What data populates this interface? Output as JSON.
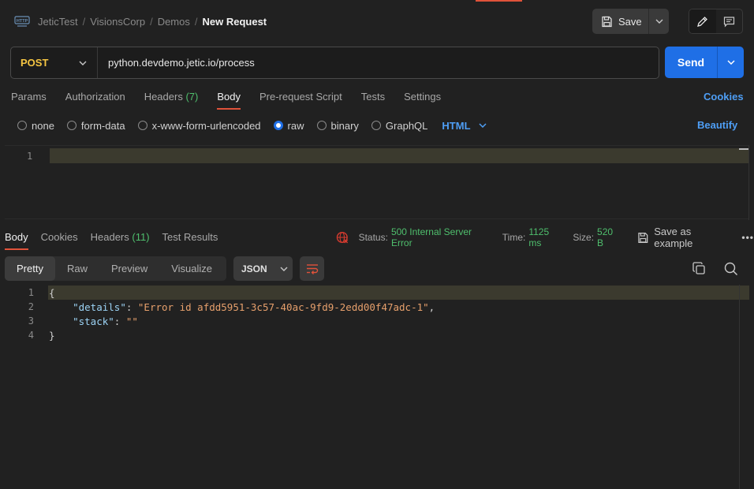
{
  "header": {
    "breadcrumb": [
      "JeticTest",
      "VisionsCorp",
      "Demos"
    ],
    "current": "New Request",
    "save_label": "Save"
  },
  "request": {
    "method": "POST",
    "url": "python.devdemo.jetic.io/process",
    "send_label": "Send"
  },
  "request_tabs": [
    {
      "label": "Params",
      "count": "",
      "active": false
    },
    {
      "label": "Authorization",
      "count": "",
      "active": false
    },
    {
      "label": "Headers",
      "count": "(7)",
      "active": false
    },
    {
      "label": "Body",
      "count": "",
      "active": true
    },
    {
      "label": "Pre-request Script",
      "count": "",
      "active": false
    },
    {
      "label": "Tests",
      "count": "",
      "active": false
    },
    {
      "label": "Settings",
      "count": "",
      "active": false
    }
  ],
  "cookies_link": "Cookies",
  "body_types": [
    {
      "label": "none",
      "checked": false
    },
    {
      "label": "form-data",
      "checked": false
    },
    {
      "label": "x-www-form-urlencoded",
      "checked": false
    },
    {
      "label": "raw",
      "checked": true
    },
    {
      "label": "binary",
      "checked": false
    },
    {
      "label": "GraphQL",
      "checked": false
    }
  ],
  "raw_format": "HTML",
  "beautify_label": "Beautify",
  "editor": {
    "line_numbers": [
      "1"
    ]
  },
  "response_tabs": [
    {
      "label": "Body",
      "count": "",
      "active": true
    },
    {
      "label": "Cookies",
      "count": "",
      "active": false
    },
    {
      "label": "Headers",
      "count": "(11)",
      "active": false
    },
    {
      "label": "Test Results",
      "count": "",
      "active": false
    }
  ],
  "status": {
    "status_label": "Status:",
    "status_value": "500 Internal Server Error",
    "time_label": "Time:",
    "time_value": "1125 ms",
    "size_label": "Size:",
    "size_value": "520 B",
    "save_example_label": "Save as example",
    "more_label": "•••"
  },
  "view_tabs": [
    {
      "label": "Pretty",
      "active": true
    },
    {
      "label": "Raw",
      "active": false
    },
    {
      "label": "Preview",
      "active": false
    },
    {
      "label": "Visualize",
      "active": false
    }
  ],
  "response_format": "JSON",
  "response_lines": [
    {
      "num": "1",
      "text": "{"
    },
    {
      "num": "2",
      "key": "\"details\"",
      "sep": ": ",
      "value": "\"Error id afdd5951-3c57-40ac-9fd9-2edd00f47adc-1\"",
      "end": ","
    },
    {
      "num": "3",
      "key": "\"stack\"",
      "sep": ": ",
      "value": "\"\"",
      "end": ""
    },
    {
      "num": "4",
      "text": "}"
    }
  ],
  "colors": {
    "accent": "#e0523a",
    "primary": "#1f6fe6",
    "link": "#4e9ef5",
    "method": "#f5c542",
    "success_text": "#4fbf6d",
    "error_icon": "#d63b2f"
  }
}
